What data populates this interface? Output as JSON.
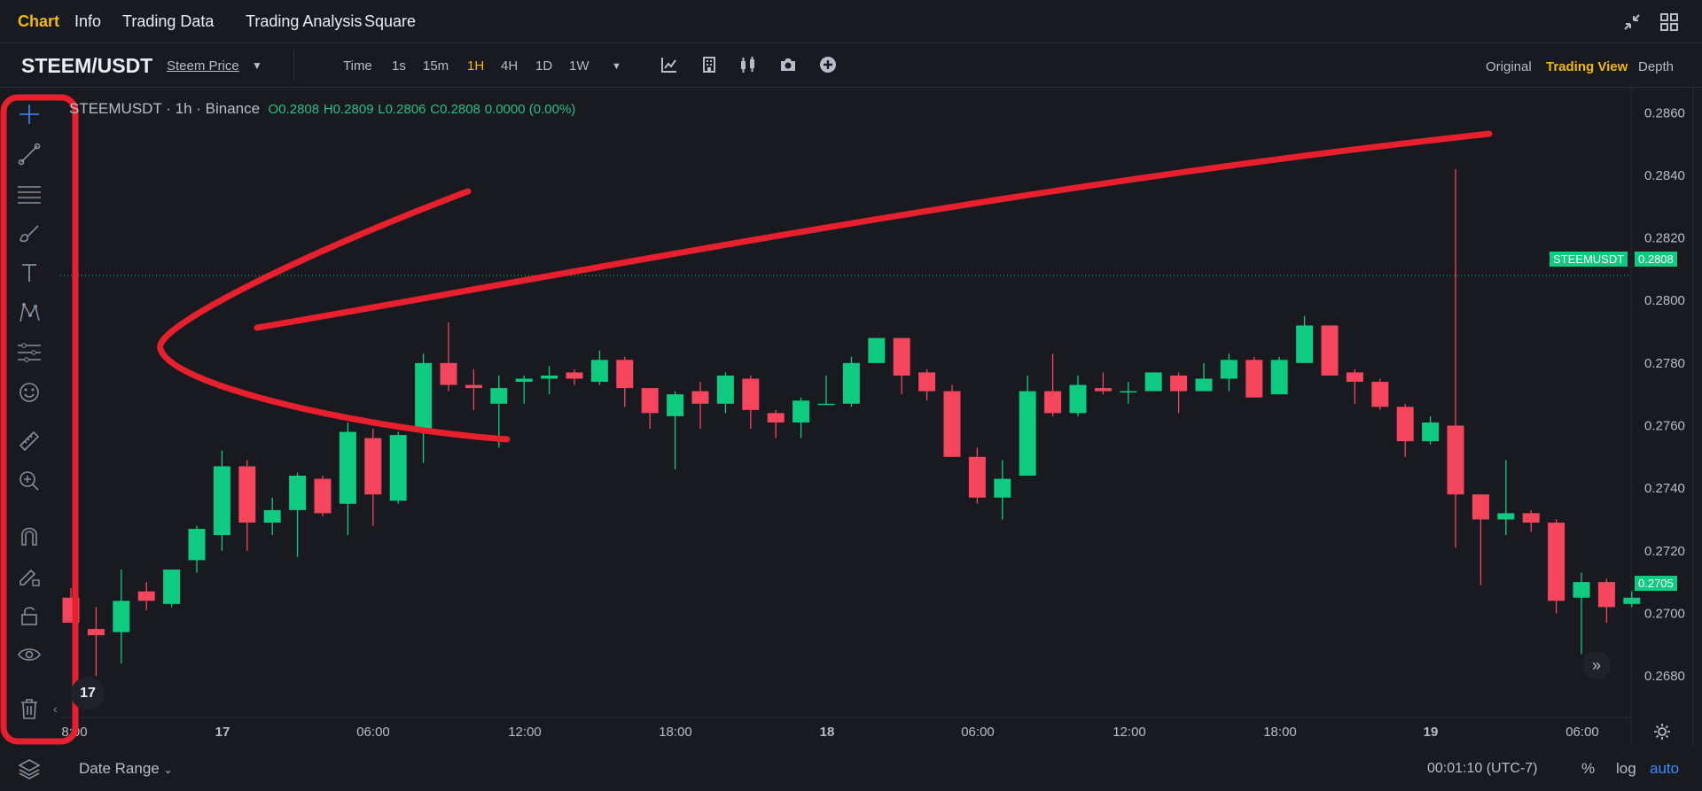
{
  "nav": {
    "items": [
      {
        "label": "Chart",
        "active": true
      },
      {
        "label": "Info",
        "active": false
      },
      {
        "label": "Trading Data",
        "active": false
      },
      {
        "label": "Trading Analysis",
        "active": false
      },
      {
        "label": "Square",
        "active": false
      }
    ],
    "right_icons": [
      "compress-icon",
      "grid-icon"
    ]
  },
  "toolbar": {
    "pair": "STEEM/USDT",
    "price_link": "Steem Price",
    "intervals": [
      {
        "label": "Time",
        "active": false
      },
      {
        "label": "1s",
        "active": false
      },
      {
        "label": "15m",
        "active": false
      },
      {
        "label": "1H",
        "active": true
      },
      {
        "label": "4H",
        "active": false
      },
      {
        "label": "1D",
        "active": false
      },
      {
        "label": "1W",
        "active": false
      }
    ],
    "tool_icons": [
      "indicator-icon",
      "building-icon",
      "candles-icon",
      "camera-icon",
      "plus-circle-icon"
    ],
    "view_modes": [
      {
        "label": "Original",
        "active": false
      },
      {
        "label": "Trading View",
        "active": true
      },
      {
        "label": "Depth",
        "active": false
      }
    ]
  },
  "left_tools": [
    "crosshair-icon",
    "trendline-icon",
    "fib-lines-icon",
    "brush-icon",
    "text-icon",
    "pattern-icon",
    "forecast-icon",
    "emoji-icon",
    "ruler-icon",
    "zoom-in-icon",
    "magnet-icon",
    "lock-pencil-icon",
    "lock-icon",
    "eye-icon",
    "trash-icon"
  ],
  "legend": {
    "symbol": "STEEMUSDT · 1h · Binance",
    "open": "O0.2808",
    "high": "H0.2809",
    "low": "L0.2806",
    "close": "C0.2808",
    "change": "0.0000 (0.00%)"
  },
  "price_tags": {
    "symbol_tag": "STEEMUSDT",
    "last_price_tag": "0.2808",
    "current_price_tag": "0.2705"
  },
  "bottom": {
    "date_range": "Date Range",
    "clock": "00:01:10 (UTC-7)",
    "percent": "%",
    "log": "log",
    "auto": "auto"
  },
  "colors": {
    "up": "#0ecb81",
    "down": "#f6465d",
    "accent": "#f0b90b",
    "annotation": "#e8202e"
  },
  "chart_data": {
    "type": "candlestick",
    "y_ticks": [
      "0.2860",
      "0.2840",
      "0.2820",
      "0.2800",
      "0.2780",
      "0.2760",
      "0.2740",
      "0.2720",
      "0.2700",
      "0.2680"
    ],
    "x_ticks": [
      "8:00",
      "17",
      "06:00",
      "12:00",
      "18:00",
      "18",
      "06:00",
      "12:00",
      "18:00",
      "19",
      "06:00"
    ],
    "ylim": [
      0.2667,
      0.2868
    ],
    "candles": [
      {
        "o": 0.2705,
        "h": 0.2708,
        "l": 0.2697,
        "c": 0.2697
      },
      {
        "o": 0.2695,
        "h": 0.2702,
        "l": 0.268,
        "c": 0.2693
      },
      {
        "o": 0.2694,
        "h": 0.2714,
        "l": 0.2684,
        "c": 0.2704
      },
      {
        "o": 0.2707,
        "h": 0.271,
        "l": 0.2701,
        "c": 0.2704
      },
      {
        "o": 0.2703,
        "h": 0.2713,
        "l": 0.2702,
        "c": 0.2714
      },
      {
        "o": 0.2717,
        "h": 0.2728,
        "l": 0.2713,
        "c": 0.2727
      },
      {
        "o": 0.2725,
        "h": 0.2752,
        "l": 0.272,
        "c": 0.2747
      },
      {
        "o": 0.2747,
        "h": 0.2749,
        "l": 0.272,
        "c": 0.2729
      },
      {
        "o": 0.2729,
        "h": 0.2737,
        "l": 0.2725,
        "c": 0.2733
      },
      {
        "o": 0.2733,
        "h": 0.2745,
        "l": 0.2718,
        "c": 0.2744
      },
      {
        "o": 0.2743,
        "h": 0.2744,
        "l": 0.2731,
        "c": 0.2732
      },
      {
        "o": 0.2735,
        "h": 0.2761,
        "l": 0.2725,
        "c": 0.2758
      },
      {
        "o": 0.2756,
        "h": 0.2759,
        "l": 0.2728,
        "c": 0.2738
      },
      {
        "o": 0.2736,
        "h": 0.2758,
        "l": 0.2735,
        "c": 0.2757
      },
      {
        "o": 0.2758,
        "h": 0.2783,
        "l": 0.2748,
        "c": 0.278
      },
      {
        "o": 0.278,
        "h": 0.2793,
        "l": 0.2771,
        "c": 0.2773
      },
      {
        "o": 0.2773,
        "h": 0.2778,
        "l": 0.2765,
        "c": 0.2772
      },
      {
        "o": 0.2767,
        "h": 0.2776,
        "l": 0.2753,
        "c": 0.2772
      },
      {
        "o": 0.2774,
        "h": 0.2776,
        "l": 0.2767,
        "c": 0.2775
      },
      {
        "o": 0.2775,
        "h": 0.2779,
        "l": 0.277,
        "c": 0.2776
      },
      {
        "o": 0.2777,
        "h": 0.2778,
        "l": 0.2773,
        "c": 0.2775
      },
      {
        "o": 0.2774,
        "h": 0.2784,
        "l": 0.2773,
        "c": 0.2781
      },
      {
        "o": 0.2781,
        "h": 0.2782,
        "l": 0.2766,
        "c": 0.2772
      },
      {
        "o": 0.2772,
        "h": 0.2772,
        "l": 0.2759,
        "c": 0.2764
      },
      {
        "o": 0.2763,
        "h": 0.2771,
        "l": 0.2746,
        "c": 0.277
      },
      {
        "o": 0.2771,
        "h": 0.2774,
        "l": 0.2759,
        "c": 0.2767
      },
      {
        "o": 0.2767,
        "h": 0.2777,
        "l": 0.2764,
        "c": 0.2776
      },
      {
        "o": 0.2775,
        "h": 0.2776,
        "l": 0.2759,
        "c": 0.2765
      },
      {
        "o": 0.2764,
        "h": 0.2765,
        "l": 0.2756,
        "c": 0.2761
      },
      {
        "o": 0.2761,
        "h": 0.2769,
        "l": 0.2756,
        "c": 0.2768
      },
      {
        "o": 0.2767,
        "h": 0.2776,
        "l": 0.2767,
        "c": 0.2767
      },
      {
        "o": 0.2767,
        "h": 0.2782,
        "l": 0.2766,
        "c": 0.278
      },
      {
        "o": 0.278,
        "h": 0.2788,
        "l": 0.278,
        "c": 0.2788
      },
      {
        "o": 0.2788,
        "h": 0.2788,
        "l": 0.277,
        "c": 0.2776
      },
      {
        "o": 0.2777,
        "h": 0.2778,
        "l": 0.2768,
        "c": 0.2771
      },
      {
        "o": 0.2771,
        "h": 0.2773,
        "l": 0.2751,
        "c": 0.275
      },
      {
        "o": 0.275,
        "h": 0.2753,
        "l": 0.2735,
        "c": 0.2737
      },
      {
        "o": 0.2737,
        "h": 0.2749,
        "l": 0.273,
        "c": 0.2743
      },
      {
        "o": 0.2744,
        "h": 0.2776,
        "l": 0.2744,
        "c": 0.2771
      },
      {
        "o": 0.2771,
        "h": 0.2783,
        "l": 0.2763,
        "c": 0.2764
      },
      {
        "o": 0.2764,
        "h": 0.2776,
        "l": 0.2763,
        "c": 0.2773
      },
      {
        "o": 0.2772,
        "h": 0.2777,
        "l": 0.277,
        "c": 0.2771
      },
      {
        "o": 0.2771,
        "h": 0.2774,
        "l": 0.2767,
        "c": 0.2771
      },
      {
        "o": 0.2771,
        "h": 0.2777,
        "l": 0.2771,
        "c": 0.2777
      },
      {
        "o": 0.2776,
        "h": 0.2777,
        "l": 0.2764,
        "c": 0.2771
      },
      {
        "o": 0.2771,
        "h": 0.278,
        "l": 0.2771,
        "c": 0.2775
      },
      {
        "o": 0.2775,
        "h": 0.2783,
        "l": 0.2771,
        "c": 0.2781
      },
      {
        "o": 0.2781,
        "h": 0.2782,
        "l": 0.2769,
        "c": 0.2769
      },
      {
        "o": 0.277,
        "h": 0.2782,
        "l": 0.277,
        "c": 0.2781
      },
      {
        "o": 0.278,
        "h": 0.2795,
        "l": 0.278,
        "c": 0.2792
      },
      {
        "o": 0.2792,
        "h": 0.2792,
        "l": 0.2776,
        "c": 0.2776
      },
      {
        "o": 0.2777,
        "h": 0.2778,
        "l": 0.2767,
        "c": 0.2774
      },
      {
        "o": 0.2774,
        "h": 0.2775,
        "l": 0.2765,
        "c": 0.2766
      },
      {
        "o": 0.2766,
        "h": 0.2767,
        "l": 0.275,
        "c": 0.2755
      },
      {
        "o": 0.2755,
        "h": 0.2763,
        "l": 0.2754,
        "c": 0.2761
      },
      {
        "o": 0.276,
        "h": 0.2842,
        "l": 0.2721,
        "c": 0.2738
      },
      {
        "o": 0.2738,
        "h": 0.2738,
        "l": 0.2709,
        "c": 0.273
      },
      {
        "o": 0.273,
        "h": 0.2749,
        "l": 0.2725,
        "c": 0.2732
      },
      {
        "o": 0.2732,
        "h": 0.2733,
        "l": 0.2726,
        "c": 0.2729
      },
      {
        "o": 0.2729,
        "h": 0.273,
        "l": 0.27,
        "c": 0.2704
      },
      {
        "o": 0.2705,
        "h": 0.2713,
        "l": 0.2687,
        "c": 0.271
      },
      {
        "o": 0.271,
        "h": 0.2711,
        "l": 0.2697,
        "c": 0.2702
      },
      {
        "o": 0.2703,
        "h": 0.2707,
        "l": 0.2702,
        "c": 0.2705
      }
    ]
  }
}
